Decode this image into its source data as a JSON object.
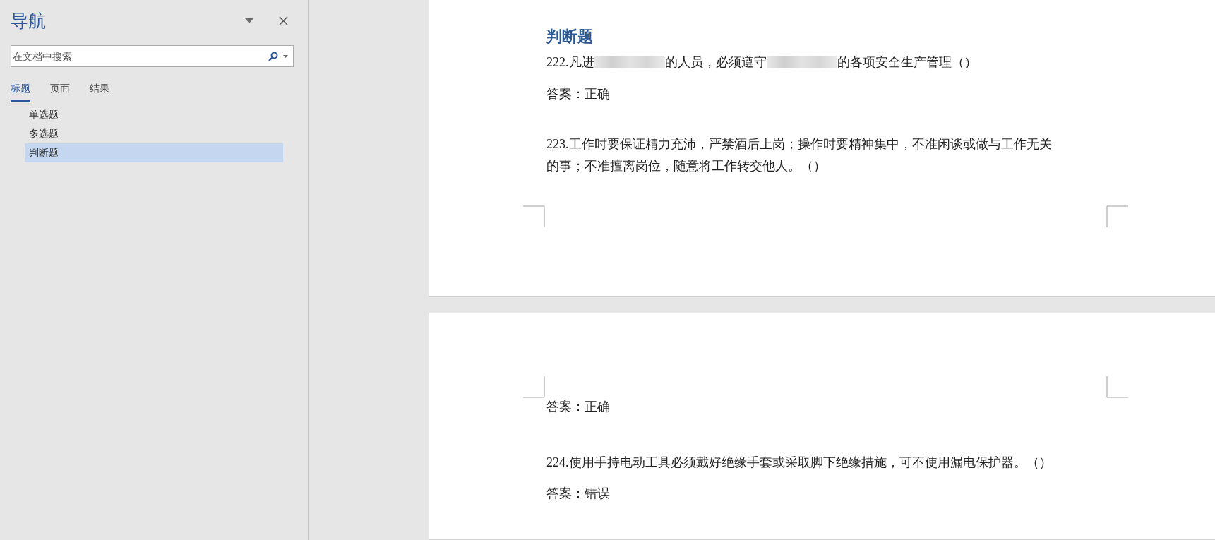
{
  "navigation": {
    "title": "导航",
    "search": {
      "placeholder": "在文档中搜索"
    },
    "tabs": [
      {
        "label": "标题",
        "selected": true
      },
      {
        "label": "页面",
        "selected": false
      },
      {
        "label": "结果",
        "selected": false
      }
    ],
    "headings": [
      {
        "label": "单选题",
        "selected": false
      },
      {
        "label": "多选题",
        "selected": false
      },
      {
        "label": "判断题",
        "selected": true
      }
    ]
  },
  "document": {
    "pages": [
      {
        "blocks": [
          {
            "kind": "heading",
            "text": "判断题"
          },
          {
            "kind": "question",
            "segments": [
              {
                "kind": "text",
                "text": "222.凡进"
              },
              {
                "kind": "redacted"
              },
              {
                "kind": "text",
                "text": "的人员，必须遵守"
              },
              {
                "kind": "redacted"
              },
              {
                "kind": "text",
                "text": "的各项安全生产管理（）"
              }
            ]
          },
          {
            "kind": "answer",
            "text": "答案：正确"
          },
          {
            "kind": "question",
            "segments": [
              {
                "kind": "text",
                "text": "223.工作时要保证精力充沛，严禁酒后上岗；操作时要精神集中，不准闲谈或做与工作无关的事；不准擅离岗位，随意将工作转交他人。（）"
              }
            ]
          }
        ]
      },
      {
        "blocks": [
          {
            "kind": "answer",
            "text": "答案：正确"
          },
          {
            "kind": "question",
            "segments": [
              {
                "kind": "text",
                "text": "224.使用手持电动工具必须戴好绝缘手套或采取脚下绝缘措施，可不使用漏电保护器。（）"
              }
            ]
          },
          {
            "kind": "answer",
            "text": "答案：错误"
          }
        ]
      }
    ]
  }
}
